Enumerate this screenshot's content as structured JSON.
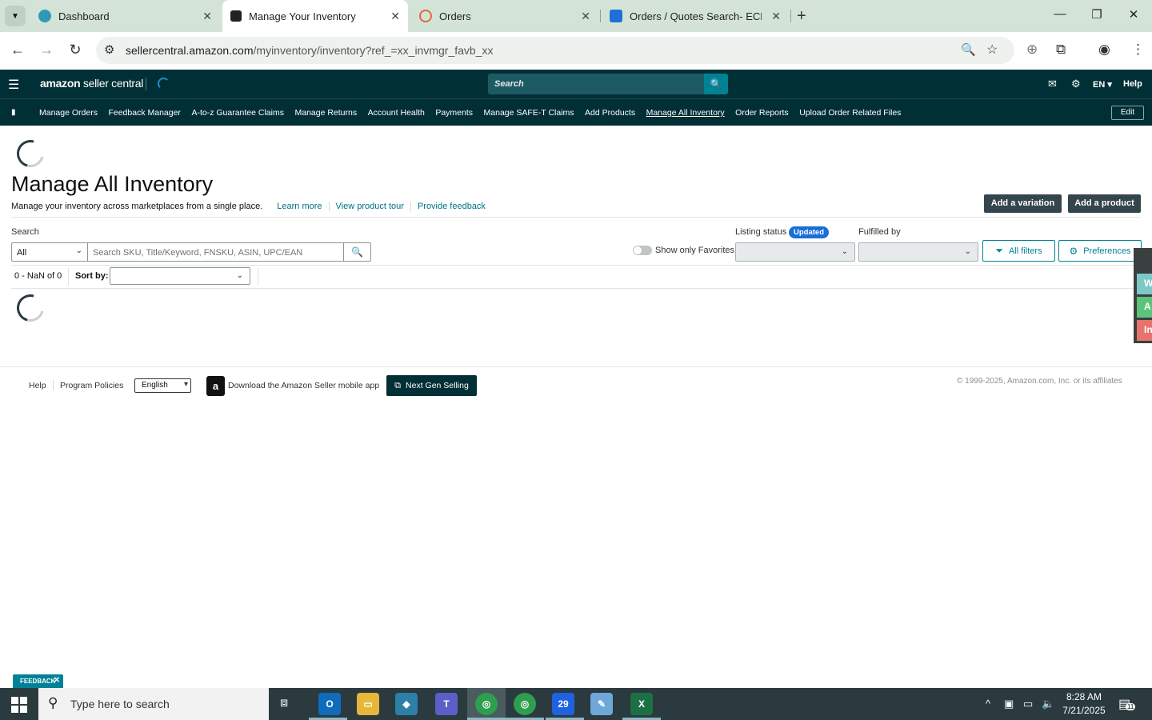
{
  "browser": {
    "tabs": [
      {
        "title": "Dashboard",
        "close": "✕"
      },
      {
        "title": "Manage Your Inventory",
        "close": "✕"
      },
      {
        "title": "Orders",
        "close": "✕"
      },
      {
        "title": "Orders / Quotes Search- ECExp",
        "close": "✕"
      }
    ],
    "new_tab": "+",
    "url_host": "sellercentral.amazon.com",
    "url_path": "/myinventory/inventory?ref_=xx_invmgr_favb_xx"
  },
  "header": {
    "logo_main": "amazon",
    "logo_sub": " seller central",
    "search_placeholder": "Search",
    "lang": "EN ▾",
    "help": "Help"
  },
  "nav": {
    "links": [
      "Manage Orders",
      "Feedback Manager",
      "A-to-z Guarantee Claims",
      "Manage Returns",
      "Account Health",
      "Payments",
      "Manage SAFE-T Claims",
      "Add Products",
      "Manage All Inventory",
      "Order Reports",
      "Upload Order Related Files"
    ],
    "edit": "Edit"
  },
  "page": {
    "title": "Manage All Inventory",
    "subtitle": "Manage your inventory across marketplaces from a single place.",
    "learn_more": "Learn more",
    "view_tour": "View product tour",
    "feedback": "Provide feedback",
    "add_variation": "Add a variation",
    "add_product": "Add a product"
  },
  "filters": {
    "search_label": "Search",
    "search_scope": "All",
    "search_placeholder": "Search SKU, Title/Keyword, FNSKU, ASIN, UPC/EAN",
    "favorites": "Show only Favorites",
    "listing_status_label": "Listing status",
    "updated_badge": "Updated",
    "fulfilled_by_label": "Fulfilled by",
    "all_filters": "All filters",
    "preferences": "Preferences"
  },
  "results": {
    "count": "0 - NaN of 0",
    "sort_by": "Sort by:"
  },
  "side_tabs": [
    {
      "label": "W",
      "color": "#7ec8c8"
    },
    {
      "label": "A",
      "color": "#5cc47a"
    },
    {
      "label": "In",
      "color": "#e8736d"
    }
  ],
  "footer": {
    "help": "Help",
    "policies": "Program Policies",
    "language": "English",
    "download_app": "Download the Amazon Seller mobile app",
    "next_gen": "Next Gen Selling",
    "copyright": "© 1999-2025, Amazon.com, Inc. or its affiliates"
  },
  "feedback_tab": "FEEDBACK",
  "taskbar": {
    "search_placeholder": "Type here to search",
    "time": "8:28 AM",
    "date": "7/21/2025",
    "notifications": "11",
    "zoom_badge": "29"
  },
  "colors": {
    "header_bg": "#002f36",
    "link": "#007185",
    "accent": "#008296"
  }
}
